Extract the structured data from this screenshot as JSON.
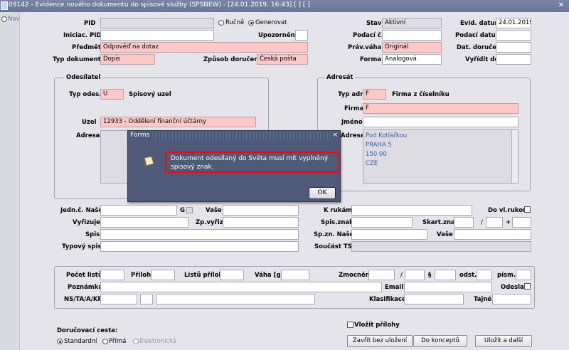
{
  "window": {
    "title": "09142 - Evidence nového dokumentu do spisové služby (SPSNEW) - [24.01.2019, 16:43] [ ] [ ]",
    "close": "✕"
  },
  "nav": {
    "label": "Nav"
  },
  "header": {
    "pid_label": "PID",
    "pid_value": "",
    "rucne_label": "Ručně",
    "generovat_label": "Generovat",
    "iniciac_pid_label": "Iniciac. PID",
    "iniciac_pid_value": "",
    "upozorneni_label": "Upozornění",
    "predmet_label": "Předmět",
    "predmet_value": "Odpověď na dotaz",
    "typ_dokumentu_label": "Typ dokumentu",
    "typ_dokumentu_value": "Dopis",
    "zpusob_doruceni_label": "Způsob doručení",
    "zpusob_doruceni_value": "Česká pošta",
    "stav_label": "Stav",
    "stav_value": "Aktivní",
    "podaci_c_label": "Podací č.",
    "podaci_c_value": "",
    "prav_vaha_label": "Práv.váha",
    "prav_vaha_value": "Originál",
    "forma_label": "Forma",
    "forma_value": "Analogová",
    "evid_datum_label": "Evid. datum",
    "evid_datum_value": "24.01.2019",
    "podaci_datum_label": "Podací datum",
    "podaci_datum_value": "",
    "dat_doruceni_label": "Dat. doručení",
    "dat_doruceni_value": "",
    "vyridit_do_label": "Vyřídit do",
    "vyridit_do_value": ""
  },
  "odesilatel": {
    "title": "Odesílatel",
    "typ_odes_label": "Typ odes.",
    "typ_odes_value": "U",
    "typ_odes_desc": "Spisový uzel",
    "uzel_label": "Uzel",
    "uzel_value": "12933 - Oddělení finanční účtárny",
    "adresa_label": "Adresa"
  },
  "adresat": {
    "title": "Adresát",
    "typ_adr_label": "Typ adr.",
    "typ_adr_value": "F",
    "typ_adr_desc": "Firma z číselníku",
    "firma_label": "Firma",
    "firma_value": "F",
    "jmeno_label": "Jméno",
    "jmeno_value": "",
    "adresa_label": "Adresa",
    "adresa_lines": [
      "Pod Kotlářkou",
      "PRAHA 5",
      "150 00",
      "CZE"
    ]
  },
  "middle": {
    "jedn_c_nase_label": "Jedn.č. Naše",
    "g_label": "G",
    "vase_label": "Vaše",
    "k_rukam_label": "K rukám",
    "do_vl_rukou_label": "Do vl.rukou",
    "vyrizuje_label": "Vyřizuje",
    "zp_vyriz_label": "Zp.vyřiz.",
    "spis_znak_label": "Spis.znak",
    "skart_znak_label": "Skart.znak",
    "slash": "/",
    "plus": "+",
    "spis_label": "Spis",
    "sp_zn_nase_label": "Sp.zn. Naše",
    "sp_zn_vase_label": "Vaše",
    "typovy_spis_label": "Typový spis",
    "soucast_ts_label": "Součást TS"
  },
  "bottom": {
    "pocet_listu_label": "Počet listů",
    "priloh_label": "Příloh",
    "listu_priloh_label": "Listů příloh",
    "vaha_label": "Váha [g]",
    "zmocneni_label": "Zmocnění",
    "slash": "/",
    "paragraph": "§",
    "odst_label": "odst.",
    "pism_label": "písm.",
    "poznamka_label": "Poznámka",
    "email_label": "Email",
    "odeslat_label": "Odeslat",
    "ns_label": "NS/TA/A/KP",
    "klasifikace_label": "Klasifikace",
    "tajne_label": "Tajné"
  },
  "footer": {
    "vlozit_prilohy_label": "Vložit přílohy",
    "dorucovaci_cesta_label": "Doručovací cesta:",
    "standardni_label": "Standardní",
    "prima_label": "Přímá",
    "elektronicka_label": "Elektronická",
    "zavrit_label": "Zavřít bez uložení",
    "koncept_label": "Do konceptů",
    "ulozit_label": "Uložit a další"
  },
  "dialog": {
    "title": "Forms",
    "close": "×",
    "message": "Dokument odesílaný do Světa musí mít vyplněný spisový znak.",
    "ok_label": "OK"
  },
  "colors": {
    "required_field": "#fcc8c8",
    "dialog_bg": "#4e5a78",
    "highlight": "#e0101a"
  }
}
